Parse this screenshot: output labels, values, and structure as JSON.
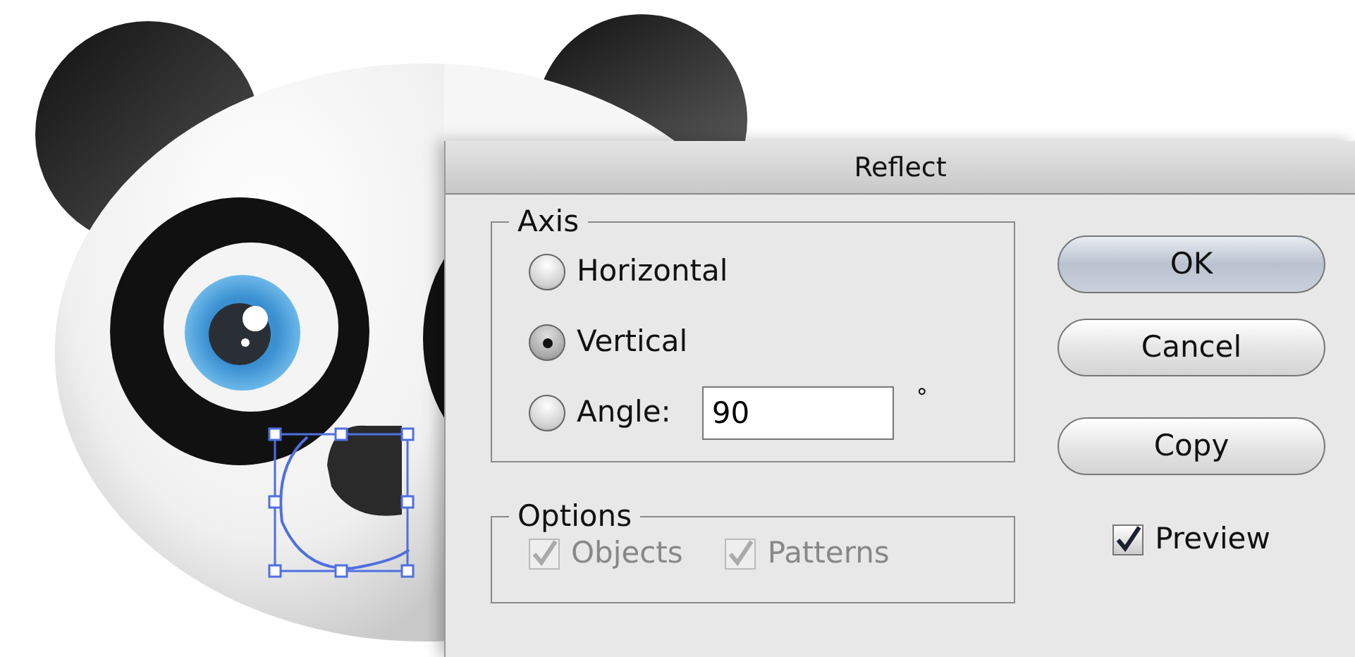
{
  "dialog": {
    "title": "Reflect",
    "axis": {
      "legend": "Axis",
      "options": [
        {
          "label": "Horizontal",
          "selected": false
        },
        {
          "label": "Vertical",
          "selected": true
        },
        {
          "label": "Angle:",
          "selected": false,
          "value": "90",
          "unit": "°"
        }
      ]
    },
    "options": {
      "legend": "Options",
      "items": [
        {
          "label": "Objects",
          "checked": true,
          "disabled": true
        },
        {
          "label": "Patterns",
          "checked": true,
          "disabled": true
        }
      ]
    },
    "buttons": [
      {
        "label": "OK",
        "default": true
      },
      {
        "label": "Cancel",
        "default": false
      },
      {
        "label": "Copy",
        "default": false
      }
    ],
    "preview": {
      "label": "Preview",
      "checked": true
    }
  }
}
